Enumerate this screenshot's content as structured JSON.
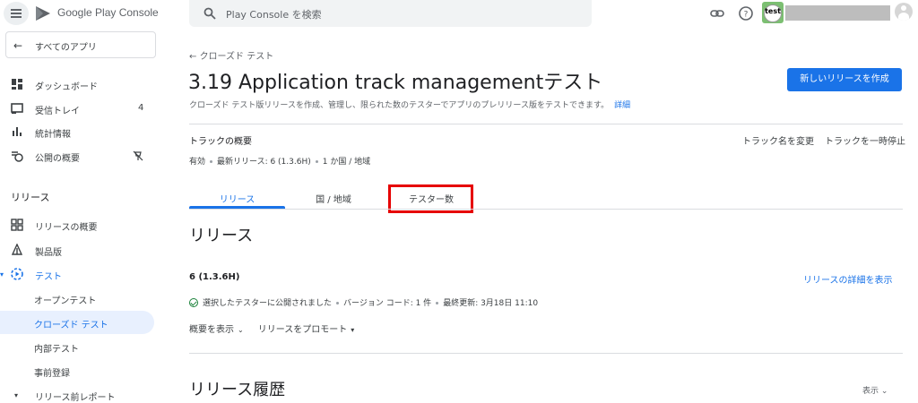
{
  "topbar": {
    "brand": "Google Play Console",
    "search_placeholder": "Play Console を検索",
    "avatar_text": "test"
  },
  "sidebar": {
    "all_apps": "すべてのアプリ",
    "items": [
      {
        "label": "ダッシュボード"
      },
      {
        "label": "受信トレイ",
        "count": "4"
      },
      {
        "label": "統計情報"
      },
      {
        "label": "公開の概要"
      }
    ],
    "release_section": "リリース",
    "release_items": [
      {
        "label": "リリースの概要"
      },
      {
        "label": "製品版"
      },
      {
        "label": "テスト"
      },
      {
        "label": "オープンテスト"
      },
      {
        "label": "クローズド テスト"
      },
      {
        "label": "内部テスト"
      },
      {
        "label": "事前登録"
      },
      {
        "label": "リリース前レポート"
      }
    ]
  },
  "main": {
    "breadcrumb": "クローズド テスト",
    "title": "3.19 Application track managementテスト",
    "new_release_button": "新しいリリースを作成",
    "description": "クローズド テスト版リリースを作成、管理し、限られた数のテスターでアプリのプレリリース版をテストできます。",
    "description_link": "詳細",
    "overview_title": "トラックの概要",
    "rename_track": "トラック名を変更",
    "pause_track": "トラックを一時停止",
    "status": {
      "state": "有効",
      "latest_release": "最新リリース: 6 (1.3.6H)",
      "regions": "1 か国 / 地域"
    },
    "tabs": [
      "リリース",
      "国 / 地域",
      "テスター数"
    ],
    "release_section_title": "リリース",
    "release": {
      "name": "6 (1.3.6H)",
      "details_link": "リリースの詳細を表示",
      "published": "選択したテスターに公開されました",
      "version_codes": "バージョン コード: 1 件",
      "last_updated": "最終更新: 3月18日 11:10",
      "show_summary": "概要を表示",
      "promote": "リリースをプロモート"
    },
    "history_title": "リリース履歴",
    "history_show": "表示"
  },
  "colors": {
    "accent": "#1a73e8",
    "highlight": "#e60000",
    "success": "#188038"
  }
}
